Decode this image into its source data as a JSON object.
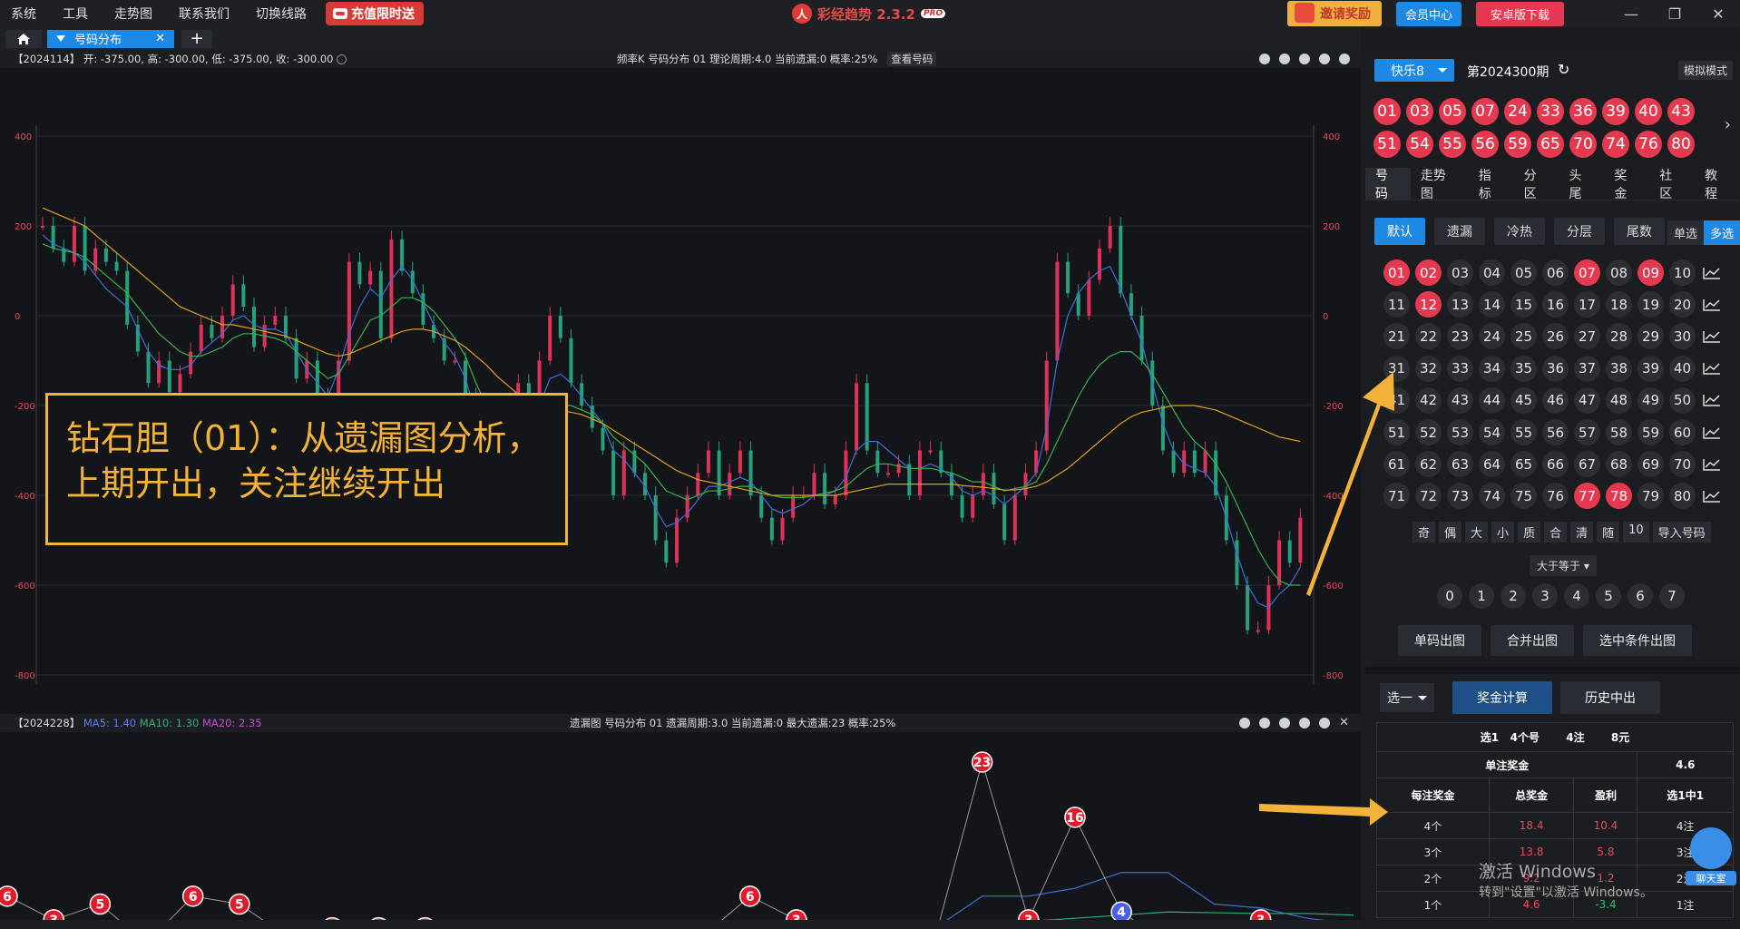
{
  "topbar": {
    "menu": [
      "系统",
      "工具",
      "走势图",
      "联系我们",
      "切换线路"
    ],
    "promo": "充值限时送",
    "brand": "彩经趋势 2.3.2",
    "brand_logo": "人",
    "pro": "PRO",
    "invite": "邀请奖励",
    "member": "会员中心",
    "android": "安卓版下载"
  },
  "tabs": {
    "active": "号码分布",
    "add": "+"
  },
  "main_panel": {
    "left_info": "【2024114】   开: -375.00, 高: -300.00, 低: -375.00, 收: -300.00",
    "mid_info": "频率K   号码分布   01     理论周期:4.0   当前遗漏:0   概率:25%",
    "view_btn": "查看号码"
  },
  "sub_panel": {
    "left_info": "【2024228】",
    "ma5": "MA5: 1.40",
    "ma10": "MA10: 1.30",
    "ma20": "MA20: 2.35",
    "mid_info": "遗漏图   号码分布   01     遗漏周期:3.0   当前遗漏:0   最大遗漏:23   概率:25%"
  },
  "callout": {
    "line1": "钻石胆（01）：从遗漏图分析，",
    "line2": "上期开出，关注继续开出"
  },
  "colors": {
    "accent": "#1e88e5",
    "ball_red": "#e53950",
    "candle_up": "#e0315a",
    "candle_down": "#26a17b",
    "ma_blue": "#3b6fd8",
    "ma_green": "#37b24d",
    "ma_orange": "#e0a020",
    "arrow": "#f3b23a"
  },
  "chart_data": [
    {
      "type": "line",
      "title": "频率K 号码分布 01",
      "y_ticks": [
        "400",
        "200",
        "0",
        "-200",
        "-400",
        "-600",
        "-800"
      ],
      "ylim": [
        -800,
        400
      ],
      "series": [
        {
          "name": "close",
          "values": [
            200,
            150,
            120,
            200,
            100,
            150,
            120,
            100,
            -20,
            -80,
            -150,
            -100,
            -170,
            -130,
            -80,
            -20,
            -50,
            0,
            70,
            20,
            -70,
            -20,
            0,
            -50,
            -140,
            -100,
            -180,
            -230,
            -100,
            120,
            70,
            100,
            -50,
            170,
            100,
            50,
            -20,
            -50,
            -100,
            -100,
            -180,
            -300,
            -350,
            -300,
            -200,
            -150,
            -280,
            -100,
            0,
            -50,
            -150,
            -200,
            -250,
            -300,
            -400,
            -300,
            -350,
            -400,
            -500,
            -550,
            -450,
            -400,
            -350,
            -300,
            -400,
            -350,
            -300,
            -400,
            -450,
            -500,
            -450,
            -400,
            -400,
            -350,
            -420,
            -400,
            -300,
            -150,
            -300,
            -350,
            -350,
            -330,
            -400,
            -300,
            -300,
            -350,
            -400,
            -450,
            -400,
            -350,
            -420,
            -500,
            -400,
            -350,
            -300,
            -100,
            120,
            50,
            0,
            80,
            150,
            200,
            50,
            0,
            -100,
            -200,
            -300,
            -350,
            -300,
            -350,
            -300,
            -400,
            -500,
            -600,
            -700,
            -700,
            -600,
            -500,
            -550,
            -450
          ]
        },
        {
          "name": "MA5",
          "values": [
            180,
            160,
            150,
            140,
            120,
            90,
            60,
            40,
            20,
            -30,
            -80,
            -110,
            -120,
            -120,
            -110,
            -80,
            -60,
            -40,
            -10,
            0,
            -20,
            -30,
            -30,
            -40,
            -80,
            -120,
            -150,
            -180,
            -120,
            -40,
            20,
            60,
            40,
            80,
            110,
            80,
            30,
            -20,
            -60,
            -90,
            -140,
            -220,
            -280,
            -320,
            -300,
            -260,
            -260,
            -200,
            -140,
            -130,
            -150,
            -180,
            -210,
            -240,
            -300,
            -320,
            -350,
            -380,
            -430,
            -470,
            -460,
            -440,
            -410,
            -380,
            -380,
            -370,
            -360,
            -370,
            -400,
            -430,
            -440,
            -430,
            -420,
            -400,
            -400,
            -390,
            -360,
            -300,
            -280,
            -280,
            -300,
            -320,
            -340,
            -340,
            -330,
            -340,
            -360,
            -390,
            -400,
            -390,
            -400,
            -420,
            -400,
            -380,
            -350,
            -250,
            -100,
            0,
            50,
            80,
            100,
            110,
            60,
            0,
            -60,
            -150,
            -240,
            -300,
            -330,
            -340,
            -350,
            -380,
            -450,
            -530,
            -600,
            -640,
            -650,
            -620,
            -600,
            -560
          ]
        },
        {
          "name": "MA10",
          "values": [
            160,
            150,
            145,
            140,
            130,
            110,
            90,
            70,
            50,
            20,
            -10,
            -40,
            -60,
            -80,
            -90,
            -90,
            -80,
            -70,
            -50,
            -40,
            -40,
            -45,
            -50,
            -60,
            -80,
            -100,
            -120,
            -140,
            -130,
            -90,
            -50,
            -10,
            0,
            20,
            40,
            40,
            30,
            10,
            -20,
            -50,
            -90,
            -150,
            -200,
            -250,
            -260,
            -260,
            -270,
            -250,
            -220,
            -200,
            -200,
            -210,
            -220,
            -240,
            -270,
            -290,
            -310,
            -330,
            -360,
            -390,
            -400,
            -410,
            -400,
            -390,
            -390,
            -385,
            -380,
            -380,
            -390,
            -400,
            -405,
            -405,
            -405,
            -400,
            -395,
            -390,
            -380,
            -360,
            -340,
            -330,
            -330,
            -335,
            -340,
            -340,
            -340,
            -345,
            -350,
            -360,
            -370,
            -370,
            -380,
            -390,
            -385,
            -380,
            -370,
            -330,
            -280,
            -230,
            -180,
            -140,
            -110,
            -90,
            -80,
            -80,
            -100,
            -130,
            -170,
            -210,
            -250,
            -280,
            -300,
            -330,
            -370,
            -420,
            -470,
            -520,
            -560,
            -590,
            -600,
            -600
          ]
        },
        {
          "name": "MA20",
          "values": [
            240,
            230,
            220,
            210,
            200,
            180,
            160,
            140,
            120,
            100,
            80,
            60,
            40,
            20,
            10,
            0,
            -10,
            -20,
            -20,
            -25,
            -30,
            -35,
            -40,
            -45,
            -55,
            -65,
            -75,
            -85,
            -90,
            -85,
            -75,
            -65,
            -55,
            -45,
            -35,
            -30,
            -30,
            -35,
            -45,
            -55,
            -70,
            -90,
            -110,
            -135,
            -155,
            -175,
            -190,
            -200,
            -205,
            -210,
            -215,
            -220,
            -230,
            -240,
            -255,
            -270,
            -285,
            -300,
            -315,
            -330,
            -345,
            -355,
            -365,
            -370,
            -375,
            -380,
            -385,
            -390,
            -395,
            -400,
            -400,
            -400,
            -400,
            -400,
            -400,
            -400,
            -395,
            -390,
            -385,
            -380,
            -375,
            -375,
            -375,
            -375,
            -375,
            -375,
            -375,
            -378,
            -380,
            -382,
            -385,
            -388,
            -388,
            -385,
            -380,
            -370,
            -355,
            -340,
            -320,
            -300,
            -280,
            -260,
            -240,
            -225,
            -215,
            -210,
            -205,
            -200,
            -200,
            -200,
            -205,
            -210,
            -220,
            -230,
            -240,
            -250,
            -260,
            -270,
            -275,
            -280
          ]
        }
      ]
    },
    {
      "type": "line",
      "title": "遗漏图 号码分布 01",
      "series": [
        {
          "name": "miss",
          "values": [
            6,
            3,
            5,
            0,
            6,
            5,
            1,
            2,
            2,
            2,
            0,
            0,
            0,
            0,
            0,
            1,
            6,
            3,
            0,
            1,
            1,
            23,
            3,
            16,
            4,
            0,
            0,
            3,
            1,
            0
          ]
        },
        {
          "name": "MA5",
          "values": [
            2,
            2,
            2,
            1.5,
            2,
            2.5,
            2.5,
            2,
            1.5,
            1.2,
            1,
            0.8,
            0.5,
            0.3,
            0.3,
            0.4,
            1,
            1.5,
            1.5,
            1.8,
            2,
            6,
            6,
            7,
            9,
            9,
            5,
            4.5,
            3.2,
            2.5
          ]
        },
        {
          "name": "MA10",
          "values": [
            1.8,
            1.8,
            1.8,
            1.7,
            1.8,
            1.9,
            1.9,
            1.8,
            1.7,
            1.6,
            1.4,
            1.2,
            1,
            0.9,
            0.8,
            0.8,
            0.9,
            1,
            1.1,
            1.2,
            1.3,
            2.6,
            2.8,
            3.2,
            3.6,
            4,
            3.9,
            3.8,
            3.8,
            3.6
          ]
        },
        {
          "name": "MA20",
          "values": [
            2,
            2,
            2,
            2,
            2,
            2,
            2,
            2,
            2,
            2,
            2,
            2,
            2,
            2,
            2,
            2,
            2,
            2,
            2,
            2,
            2,
            2.2,
            2.3,
            2.4,
            2.4,
            2.4,
            2.4,
            2.4,
            2.35,
            2.35
          ]
        }
      ]
    }
  ],
  "right": {
    "lottery": "快乐8",
    "period": "第2024300期",
    "mode": "模拟模式",
    "results_row1": [
      "01",
      "03",
      "05",
      "07",
      "24",
      "33",
      "36",
      "39",
      "40",
      "43"
    ],
    "results_row2": [
      "51",
      "54",
      "55",
      "56",
      "59",
      "65",
      "70",
      "74",
      "76",
      "80"
    ],
    "nav": [
      "号码",
      "走势图",
      "指标",
      "分区",
      "头尾",
      "奖金",
      "社区",
      "教程"
    ],
    "subtabs": [
      "默认",
      "遗漏",
      "冷热",
      "分层",
      "尾数"
    ],
    "single": "单选",
    "multi": "多选",
    "selected": [
      "01",
      "02",
      "07",
      "09",
      "12",
      "77",
      "78"
    ],
    "filters": [
      "奇",
      "偶",
      "大",
      "小",
      "质",
      "合",
      "清",
      "随",
      "10",
      "导入号码"
    ],
    "gte": "大于等于 ▾",
    "digits": [
      "0",
      "1",
      "2",
      "3",
      "4",
      "5",
      "6",
      "7"
    ],
    "out_btns": [
      "单码出图",
      "合并出图",
      "选中条件出图"
    ],
    "pick": "选一",
    "calc": "奖金计算",
    "hist": "历史中出",
    "summary": {
      "a": "选1",
      "b": "4个号",
      "c": "4注",
      "d": "8元"
    },
    "single_prize_label": "单注奖金",
    "single_prize": "4.6",
    "headers": [
      "每注奖金",
      "总奖金",
      "盈利",
      "选1中1"
    ],
    "rows": [
      [
        "4个",
        "18.4",
        "10.4",
        "4注"
      ],
      [
        "3个",
        "13.8",
        "5.8",
        "3注"
      ],
      [
        "2个",
        "9.2",
        "1.2",
        "2注"
      ],
      [
        "1个",
        "4.6",
        "-3.4",
        "1注"
      ]
    ]
  },
  "watermark": {
    "line1": "激活 Windows",
    "line2": "转到\"设置\"以激活 Windows。"
  },
  "chat": "聊天室"
}
